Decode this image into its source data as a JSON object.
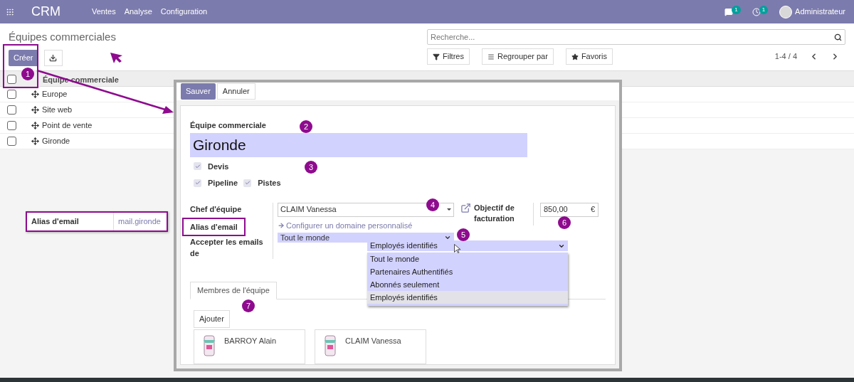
{
  "navbar": {
    "app_name": "CRM",
    "menu": [
      "Ventes",
      "Analyse",
      "Configuration"
    ],
    "messages_badge": "1",
    "activities_badge": "1",
    "user": "Administrateur"
  },
  "control_panel": {
    "title": "Équipes commerciales",
    "create_button": "Créer",
    "search_placeholder": "Recherche...",
    "filters": [
      "Filtres",
      "Regrouper par",
      "Favoris"
    ],
    "pager": "1-4 / 4"
  },
  "table": {
    "columns": [
      "Équipe commerciale"
    ],
    "select_all_checked": false,
    "rows": [
      {
        "name": "Europe",
        "checked": false
      },
      {
        "name": "Site web",
        "checked": false
      },
      {
        "name": "Point de vente",
        "checked": false
      },
      {
        "name": "Gironde",
        "checked": false
      }
    ]
  },
  "form": {
    "save_button": "Sauver",
    "discard_button": "Annuler",
    "name_label": "Équipe commerciale",
    "name": "Gironde",
    "options": [
      {
        "label": "Devis",
        "checked": true
      },
      {
        "label": "Pipeline",
        "checked": true
      },
      {
        "label": "Pistes",
        "checked": true
      }
    ],
    "leader_label": "Chef d'équipe",
    "leader": "CLAIM Vanessa",
    "alias_label": "Alias d'email",
    "configure_link": "Configurer un domaine personnalisé",
    "accept_label": "Accepter les emails de",
    "accept_value": "Tout le monde",
    "target_label": "Objectif de facturation",
    "target_value": "850,00",
    "currency": "€",
    "tabs": [
      {
        "label": "Membres de l'équipe",
        "selected": true
      }
    ],
    "add_button": "Ajouter",
    "members": [
      {
        "name": "BARROY Alain"
      },
      {
        "name": "CLAIM Vanessa"
      }
    ]
  },
  "dropdown": {
    "value": "Employés identifiés",
    "options": [
      {
        "label": "Tout le monde",
        "selected": false
      },
      {
        "label": "Partenaires Authentifiés",
        "selected": false
      },
      {
        "label": "Abonnés seulement",
        "selected": false
      },
      {
        "label": "Employés identifiés",
        "selected": true
      }
    ]
  },
  "annotations": {
    "markers": [
      "1",
      "2",
      "3",
      "4",
      "5",
      "6",
      "7"
    ],
    "alias_callout": {
      "label": "Alias d'email",
      "value": "mail.gironde"
    }
  }
}
